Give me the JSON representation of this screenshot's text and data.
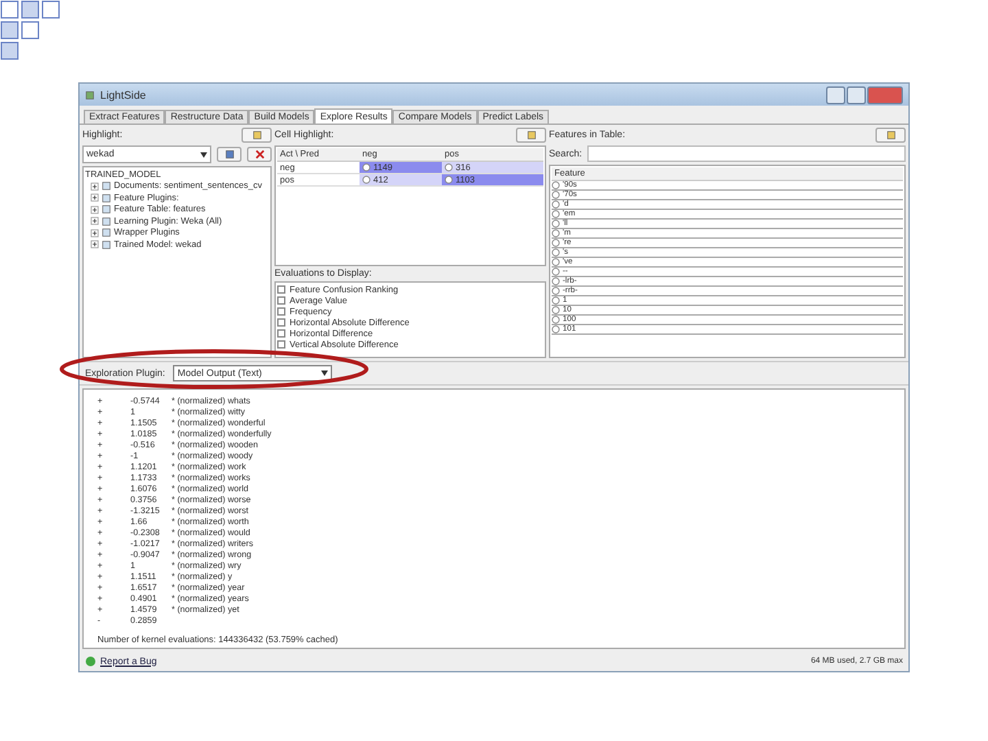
{
  "window": {
    "title": "LightSide"
  },
  "tabs": [
    {
      "label": "Extract Features",
      "selected": false
    },
    {
      "label": "Restructure Data",
      "selected": false
    },
    {
      "label": "Build Models",
      "selected": false
    },
    {
      "label": "Explore Results",
      "selected": true
    },
    {
      "label": "Compare Models",
      "selected": false
    },
    {
      "label": "Predict Labels",
      "selected": false
    }
  ],
  "highlight": {
    "label": "Highlight:",
    "model": "wekad",
    "tree": {
      "label": "TRAINED_MODEL",
      "children": [
        {
          "label": "Documents: sentiment_sentences_cv",
          "expanded": false
        },
        {
          "label": "Feature Plugins:",
          "expanded": false
        },
        {
          "label": "Feature Table: features",
          "expanded": false
        },
        {
          "label": "Learning Plugin: Weka (All)",
          "expanded": false
        },
        {
          "label": "Wrapper Plugins",
          "expanded": false
        },
        {
          "label": "Trained Model: wekad",
          "expanded": false
        }
      ]
    }
  },
  "cell_highlight": {
    "label": "Cell Highlight:",
    "columns": [
      "Act \\ Pred",
      "neg",
      "pos"
    ],
    "rows": [
      {
        "label": "neg",
        "cells": [
          {
            "value": "1149",
            "kind": "strong"
          },
          {
            "value": "316",
            "kind": "weak"
          }
        ]
      },
      {
        "label": "pos",
        "cells": [
          {
            "value": "412",
            "kind": "weak"
          },
          {
            "value": "1103",
            "kind": "strong"
          }
        ]
      }
    ]
  },
  "evaluations": {
    "label": "Evaluations to Display:",
    "items": [
      {
        "label": "Feature Confusion Ranking",
        "checked": false
      },
      {
        "label": "Average Value",
        "checked": false
      },
      {
        "label": "Frequency",
        "checked": false
      },
      {
        "label": "Horizontal Absolute Difference",
        "checked": false
      },
      {
        "label": "Horizontal Difference",
        "checked": false
      },
      {
        "label": "Vertical Absolute Difference",
        "checked": false
      }
    ]
  },
  "features": {
    "label": "Features in Table:",
    "search_label": "Search:",
    "column": "Feature",
    "items": [
      "'90s",
      "'70s",
      "'d",
      "'em",
      "'ll",
      "'m",
      "'re",
      "'s",
      "'ve",
      "--",
      "-lrb-",
      "-rrb-",
      "1",
      "10",
      "100",
      "101"
    ]
  },
  "exploration": {
    "label": "Exploration Plugin:",
    "value": "Model Output (Text)"
  },
  "output": {
    "lines": [
      {
        "sign": "+",
        "coef": "-0.5744",
        "term": "* (normalized) whats"
      },
      {
        "sign": "+",
        "coef": "1",
        "term": "* (normalized) witty"
      },
      {
        "sign": "+",
        "coef": "1.1505",
        "term": "* (normalized) wonderful"
      },
      {
        "sign": "+",
        "coef": "1.0185",
        "term": "* (normalized) wonderfully"
      },
      {
        "sign": "+",
        "coef": "-0.516",
        "term": "* (normalized) wooden"
      },
      {
        "sign": "+",
        "coef": "-1",
        "term": "* (normalized) woody"
      },
      {
        "sign": "+",
        "coef": "1.1201",
        "term": "* (normalized) work"
      },
      {
        "sign": "+",
        "coef": "1.1733",
        "term": "* (normalized) works"
      },
      {
        "sign": "+",
        "coef": "1.6076",
        "term": "* (normalized) world"
      },
      {
        "sign": "+",
        "coef": "0.3756",
        "term": "* (normalized) worse"
      },
      {
        "sign": "+",
        "coef": "-1.3215",
        "term": "* (normalized) worst"
      },
      {
        "sign": "+",
        "coef": "1.66",
        "term": "* (normalized) worth"
      },
      {
        "sign": "+",
        "coef": "-0.2308",
        "term": "* (normalized) would"
      },
      {
        "sign": "+",
        "coef": "-1.0217",
        "term": "* (normalized) writers"
      },
      {
        "sign": "+",
        "coef": "-0.9047",
        "term": "* (normalized) wrong"
      },
      {
        "sign": "+",
        "coef": "1",
        "term": "* (normalized) wry"
      },
      {
        "sign": "+",
        "coef": "1.1511",
        "term": "* (normalized) y"
      },
      {
        "sign": "+",
        "coef": "1.6517",
        "term": "* (normalized) year"
      },
      {
        "sign": "+",
        "coef": "0.4901",
        "term": "* (normalized) years"
      },
      {
        "sign": "+",
        "coef": "1.4579",
        "term": "* (normalized) yet"
      },
      {
        "sign": "-",
        "coef": "0.2859"
      }
    ],
    "summary": "Number of kernel evaluations: 144336432 (53.759% cached)"
  },
  "status_bar": {
    "link": "Report a Bug",
    "memory": "64 MB used, 2.7 GB max"
  }
}
